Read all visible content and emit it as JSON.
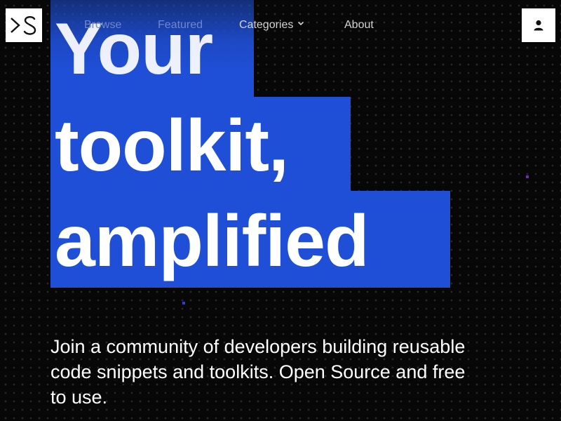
{
  "logo": {
    "text": ">S"
  },
  "nav": {
    "items": [
      {
        "label": "Browse"
      },
      {
        "label": "Featured"
      },
      {
        "label": "Categories"
      },
      {
        "label": "About"
      }
    ]
  },
  "user": {
    "icon": "user-icon"
  },
  "hero": {
    "lines": [
      "Your",
      "toolkit,",
      "amplified"
    ],
    "subtitle": "Join a community of developers building reusable code snippets and toolkits. Open Source and free to use."
  },
  "colors": {
    "background": "#070707",
    "accent": "#1f4fd6",
    "dot_purple": "#6b2fb3",
    "dot_blue": "#2a3fd6"
  }
}
